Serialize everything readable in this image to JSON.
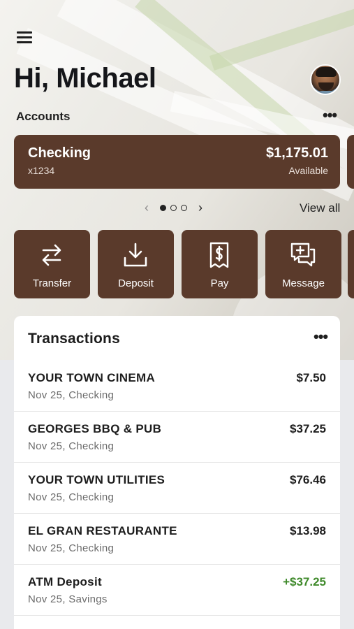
{
  "greeting": "Hi, Michael",
  "accounts": {
    "label": "Accounts",
    "card": {
      "name": "Checking",
      "number": "x1234",
      "balance": "$1,175.01",
      "balance_label": "Available"
    },
    "pager": {
      "prev_icon": "‹",
      "next_icon": "›",
      "pages": 3,
      "current": 1
    },
    "view_all": "View all"
  },
  "actions": [
    {
      "label": "Transfer",
      "icon": "transfer-icon"
    },
    {
      "label": "Deposit",
      "icon": "deposit-icon"
    },
    {
      "label": "Pay",
      "icon": "pay-icon"
    },
    {
      "label": "Message",
      "icon": "message-icon"
    }
  ],
  "transactions": {
    "title": "Transactions",
    "items": [
      {
        "merchant": "YOUR TOWN CINEMA",
        "meta": "Nov 25, Checking",
        "amount": "$7.50",
        "type": "debit"
      },
      {
        "merchant": "GEORGES BBQ & PUB",
        "meta": "Nov 25, Checking",
        "amount": "$37.25",
        "type": "debit"
      },
      {
        "merchant": "YOUR TOWN UTILITIES",
        "meta": "Nov 25, Checking",
        "amount": "$76.46",
        "type": "debit"
      },
      {
        "merchant": "EL GRAN RESTAURANTE",
        "meta": "Nov 25, Checking",
        "amount": "$13.98",
        "type": "debit"
      },
      {
        "merchant": "ATM Deposit",
        "meta": "Nov 25, Savings",
        "amount": "+$37.25",
        "type": "credit"
      }
    ]
  },
  "colors": {
    "brand_brown": "#5a3a2b",
    "credit_green": "#3f8a2b",
    "text_dark": "#1d1d1d",
    "text_muted": "#6b6b6b"
  },
  "icons": {
    "menu": "menu-icon",
    "more": "more-icon",
    "avatar": "avatar"
  }
}
